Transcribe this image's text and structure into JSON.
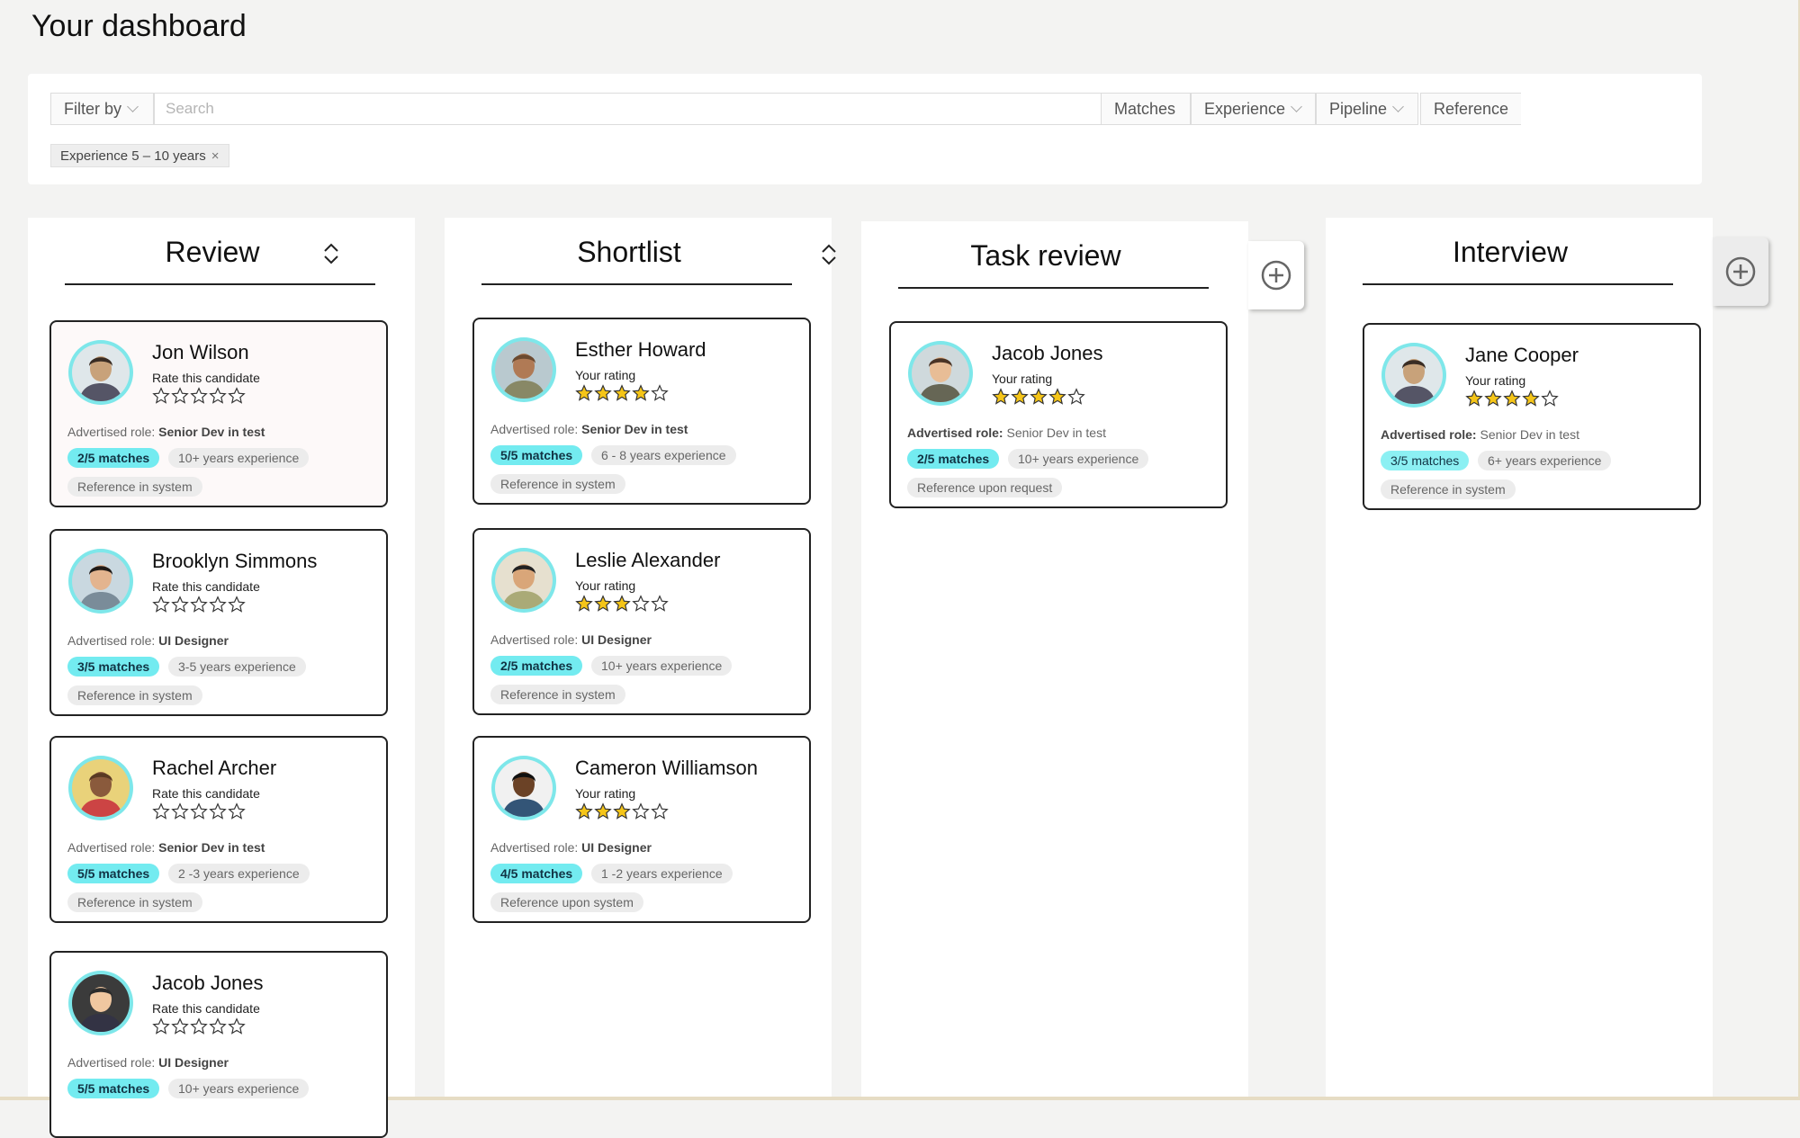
{
  "page_title": "Your dashboard",
  "filters": {
    "filter_by": "Filter by",
    "search_placeholder": "Search",
    "matches": "Matches",
    "experience": "Experience",
    "pipeline": "Pipeline",
    "reference": "Reference",
    "active_chip": "Experience 5 – 10 years",
    "chip_remove": "×"
  },
  "colors": {
    "accent": "#73ebf0",
    "star_filled": "#f5c518",
    "border": "#222222"
  },
  "columns": [
    {
      "title": "Review"
    },
    {
      "title": "Shortlist"
    },
    {
      "title": "Task review"
    },
    {
      "title": "Interview"
    }
  ],
  "role_prefix": "Advertised role:",
  "cards": {
    "review": [
      {
        "name": "Jon Wilson",
        "rating_label": "Rate this candidate",
        "rating": 0,
        "role": "Senior Dev in test",
        "matches": "2/5 matches",
        "experience": "10+ years experience",
        "reference": "Reference in system"
      },
      {
        "name": "Brooklyn Simmons",
        "rating_label": "Rate this candidate",
        "rating": 0,
        "role": "UI Designer",
        "matches": "3/5 matches",
        "experience": "3-5 years experience",
        "reference": "Reference in system"
      },
      {
        "name": "Rachel Archer",
        "rating_label": "Rate this candidate",
        "rating": 0,
        "role": "Senior Dev in test",
        "matches": "5/5 matches",
        "experience": "2 -3 years experience",
        "reference": "Reference in system"
      },
      {
        "name": "Jacob Jones",
        "rating_label": "Rate this candidate",
        "rating": 0,
        "role": "UI Designer",
        "matches": "5/5 matches",
        "experience": "10+ years experience",
        "reference": ""
      }
    ],
    "shortlist": [
      {
        "name": "Esther Howard",
        "rating_label": "Your rating",
        "rating": 4,
        "role": "Senior Dev in test",
        "matches": "5/5 matches",
        "experience": "6 - 8 years experience",
        "reference": "Reference in system"
      },
      {
        "name": "Leslie Alexander",
        "rating_label": "Your rating",
        "rating": 3,
        "role": "UI Designer",
        "matches": "2/5 matches",
        "experience": "10+ years experience",
        "reference": "Reference in system"
      },
      {
        "name": "Cameron Williamson",
        "rating_label": "Your rating",
        "rating": 3,
        "role": "UI Designer",
        "matches": "4/5 matches",
        "experience": "1 -2 years experience",
        "reference": "Reference upon system"
      }
    ],
    "task_review": [
      {
        "name": "Jacob Jones",
        "rating_label": "Your rating",
        "rating": 4,
        "role": "Senior Dev in test",
        "matches": "2/5 matches",
        "experience": "10+ years experience",
        "reference": "Reference upon request"
      }
    ],
    "interview": [
      {
        "name": "Jane Cooper",
        "rating_label": "Your rating",
        "rating": 4,
        "role": "Senior Dev in test",
        "matches": "3/5 matches",
        "experience": "6+ years experience",
        "reference": "Reference in system"
      }
    ]
  }
}
